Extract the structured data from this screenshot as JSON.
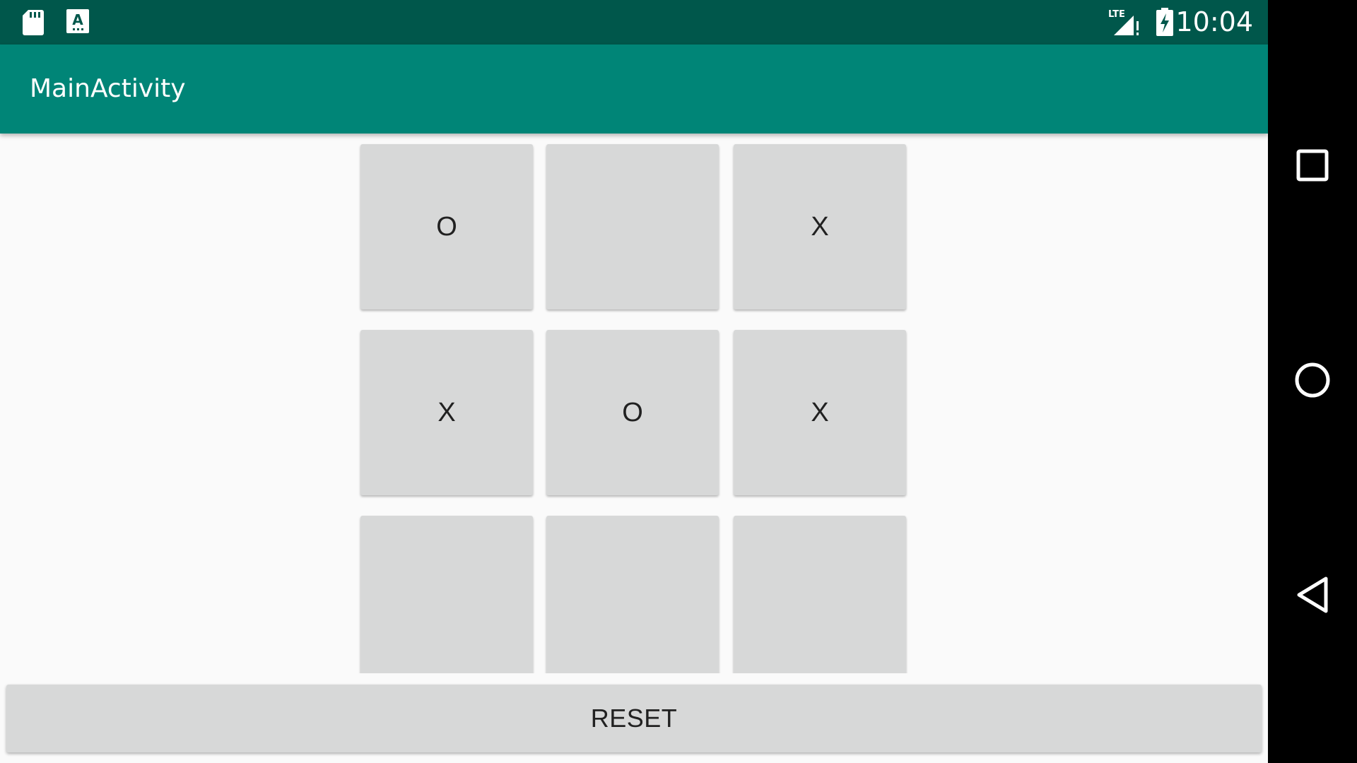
{
  "status_bar": {
    "time": "10:04",
    "icons": [
      "sd-card-icon",
      "keyboard-a-icon",
      "lte-signal-icon",
      "battery-charging-icon"
    ],
    "network_label": "LTE"
  },
  "app_bar": {
    "title": "MainActivity"
  },
  "board": {
    "cells": [
      [
        "O",
        "",
        "X"
      ],
      [
        "X",
        "O",
        "X"
      ],
      [
        "",
        "",
        ""
      ]
    ]
  },
  "reset_button": {
    "label": "RESET"
  },
  "nav_bar": {
    "buttons": [
      "recents-square-icon",
      "home-circle-icon",
      "back-triangle-icon"
    ]
  },
  "colors": {
    "status_bar": "#00574b",
    "app_bar": "#008577",
    "background": "#fafafa",
    "button": "#d7d8d8",
    "nav_bar": "#000000"
  }
}
